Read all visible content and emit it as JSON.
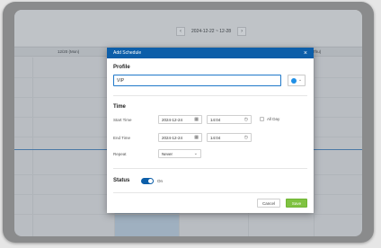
{
  "calendar": {
    "prev_icon": "chevron-left-icon",
    "next_icon": "chevron-right-icon",
    "prev_glyph": "‹",
    "next_glyph": "›",
    "date_range": "2024-12-22 ~ 12-28",
    "columns": [
      "12/20 (Mon)",
      "12/26 (Thu)"
    ]
  },
  "modal": {
    "title": "Add Schedule",
    "close_glyph": "×",
    "profile_section": "Profile",
    "profile_value": "VIP",
    "color_chevron": "⌄",
    "time_section": "Time",
    "start_label": "Start Time",
    "start_date": "2024-12-24",
    "start_time": "14:04",
    "end_label": "End Time",
    "end_date": "2024-12-24",
    "end_time": "14:04",
    "all_day_label": "All Day",
    "repeat_label": "Repeat",
    "repeat_value": "Never",
    "repeat_chevron": "⌄",
    "status_section": "Status",
    "status_value": "On",
    "cancel_label": "Cancel",
    "save_label": "Save",
    "calendar_glyph": "▦",
    "clock_glyph": "◷"
  },
  "colors": {
    "header_blue": "#0c5ea9",
    "save_green": "#7fc241",
    "accent_dot": "#1f8fe6"
  }
}
